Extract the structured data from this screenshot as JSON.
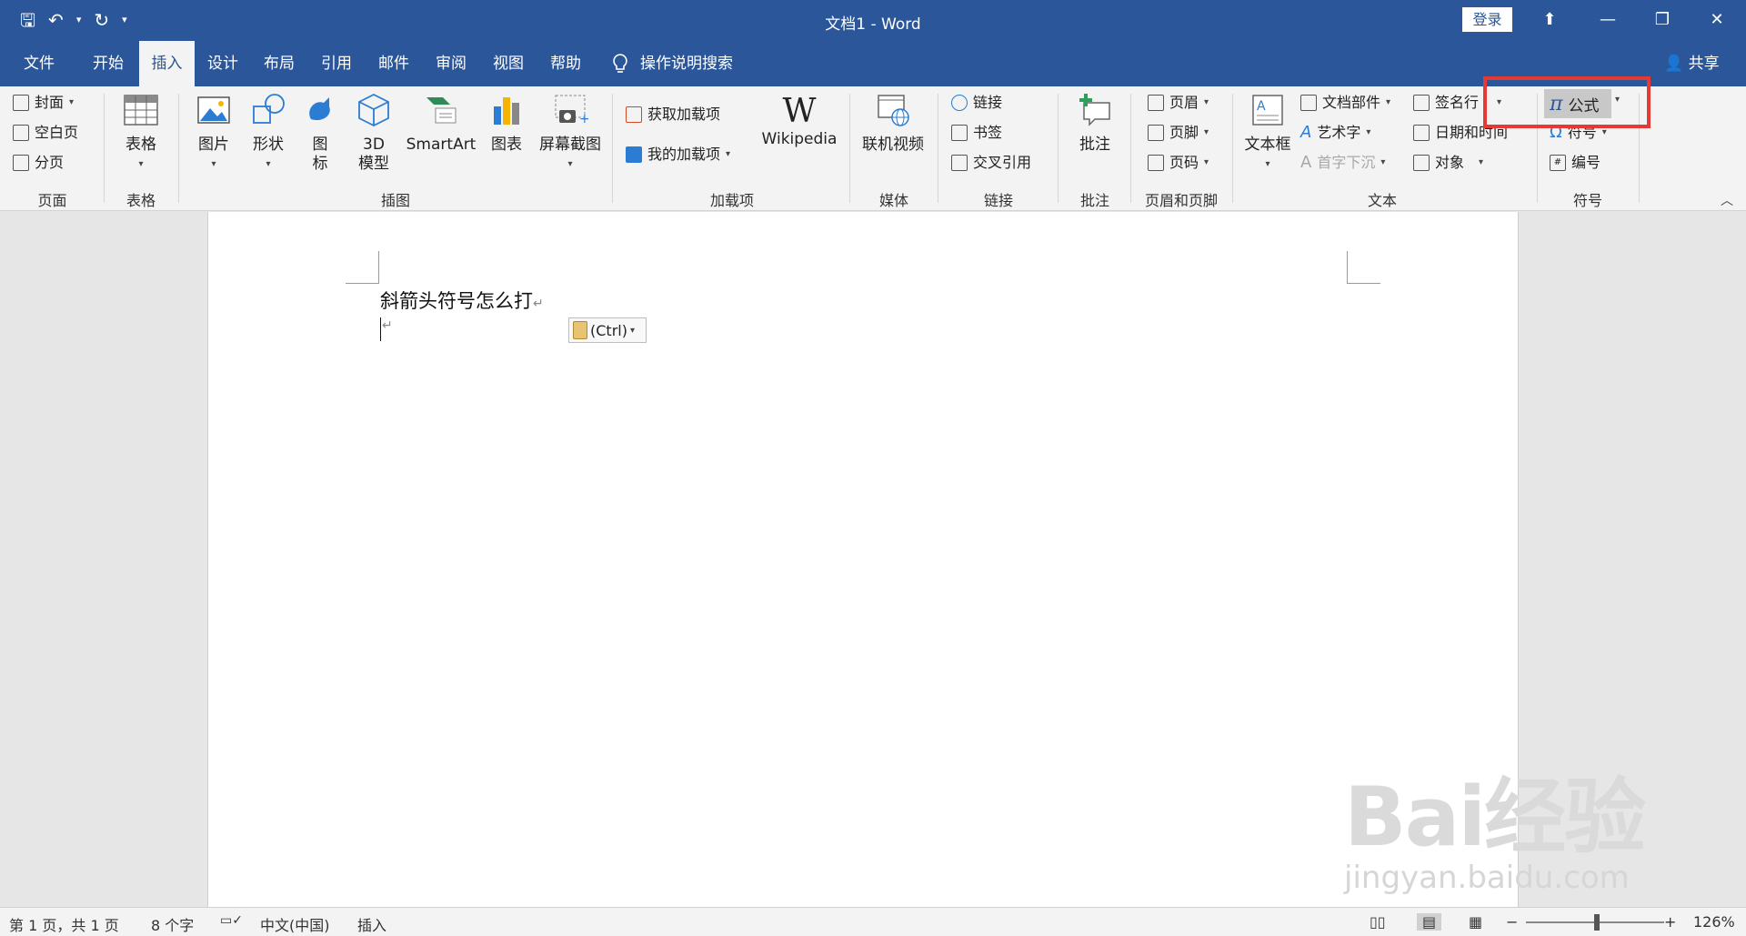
{
  "window": {
    "title": "文档1  -  Word",
    "login": "登录"
  },
  "qat": {
    "save": "🖫",
    "undo": "↶",
    "undo_dd": "▾",
    "redo": "↻",
    "customize": "▾"
  },
  "win_controls": {
    "ribbon_display": "⬆",
    "minimize": "—",
    "restore": "❐",
    "close": "✕"
  },
  "tabs": [
    "文件",
    "开始",
    "插入",
    "设计",
    "布局",
    "引用",
    "邮件",
    "审阅",
    "视图",
    "帮助"
  ],
  "active_tab": "插入",
  "tellme": {
    "icon": "lightbulb-icon",
    "label": "操作说明搜索"
  },
  "share": "共享",
  "ribbon": {
    "pages": {
      "label": "页面",
      "cover": "封面",
      "blank": "空白页",
      "break": "分页"
    },
    "tables": {
      "label": "表格",
      "table": "表格"
    },
    "illustrations": {
      "label": "插图",
      "picture": "图片",
      "shapes": "形状",
      "icons_l1": "图",
      "icons_l2": "标",
      "model_l1": "3D",
      "model_l2": "模型",
      "smartart": "SmartArt",
      "chart": "图表",
      "screenshot": "屏幕截图"
    },
    "addins": {
      "label": "加载项",
      "get": "获取加载项",
      "mine": "我的加载项",
      "wikipedia": "Wikipedia"
    },
    "media": {
      "label": "媒体",
      "video": "联机视频"
    },
    "links": {
      "label": "链接",
      "link": "链接",
      "bookmark": "书签",
      "crossref": "交叉引用"
    },
    "comments": {
      "label": "批注",
      "comment": "批注"
    },
    "header_footer": {
      "label": "页眉和页脚",
      "header": "页眉",
      "footer": "页脚",
      "page_number": "页码"
    },
    "text": {
      "label": "文本",
      "textbox": "文本框",
      "quickparts": "文档部件",
      "wordart": "艺术字",
      "dropcap": "首字下沉",
      "signature": "签名行",
      "datetime": "日期和时间",
      "object": "对象"
    },
    "symbols": {
      "label": "符号",
      "equation": "公式",
      "symbol": "符号",
      "number": "编号",
      "pi": "π",
      "omega": "Ω",
      "hash": "#"
    }
  },
  "document": {
    "line1": "斜箭头符号怎么打",
    "para_mark": "↵",
    "paste_label": "(Ctrl)"
  },
  "watermark": {
    "main": "Bai经验",
    "sub": "jingyan.baidu.com"
  },
  "status": {
    "page": "第 1 页，共 1 页",
    "words": "8 个字",
    "language": "中文(中国)",
    "mode": "插入",
    "zoom": "126%",
    "zoom_minus": "−",
    "zoom_plus": "+"
  },
  "colors": {
    "brand": "#2b579a",
    "highlight": "#e53935"
  }
}
